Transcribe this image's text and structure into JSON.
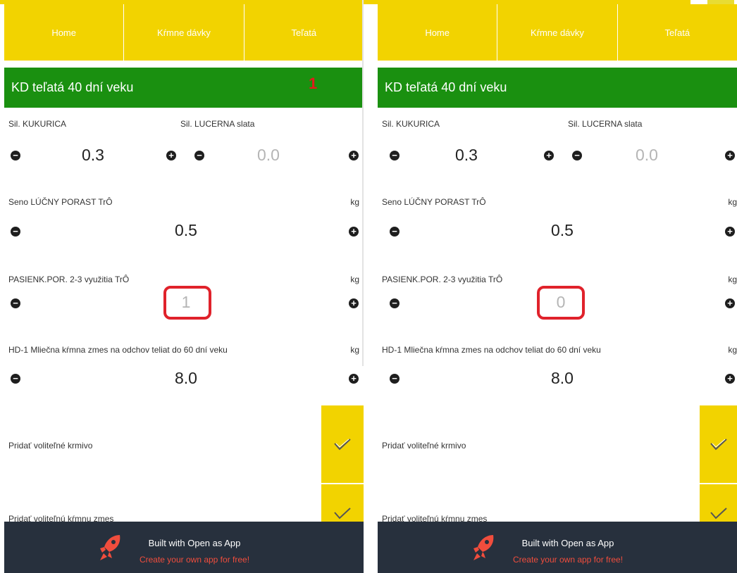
{
  "nav": {
    "tabs": [
      "Home",
      "Kŕmne dávky",
      "Teľatá"
    ]
  },
  "banner": {
    "title": "KD teľatá 40 dní veku",
    "badge": "1"
  },
  "rows": [
    {
      "label_left": "Sil. KUKURICA",
      "label_right": "Sil. LUCERNA slata",
      "value_left": "0.3",
      "value_right": "0.0"
    },
    {
      "label": "Seno LÚČNY PORAST TrÔ",
      "unit": "kg",
      "value": "0.5"
    },
    {
      "label": "PASIENK.POR. 2-3 využitia TrÔ",
      "unit": "kg"
    },
    {
      "label": "HD-1 Mliečna kŕmna zmes na odchov teliat do 60 dní veku",
      "unit": "kg",
      "value": "8.0"
    }
  ],
  "screens": {
    "left": {
      "pasienk_value": "1"
    },
    "right": {
      "pasienk_value": "0"
    }
  },
  "options": {
    "add_feed": "Pridať voliteľné krmivo",
    "add_mix": "Pridať voliteľnú kŕmnu zmes"
  },
  "promo": {
    "title": "Built with Open as App",
    "subtitle": "Create your own app for free!"
  },
  "icons": {
    "minus": "minus-circle-icon",
    "plus": "plus-circle-icon",
    "check": "check-icon",
    "rocket": "rocket-icon"
  },
  "colors": {
    "nav": "#f2d300",
    "banner": "#1a9010",
    "badge": "#e21b1b",
    "highlight": "#e0222b",
    "promo_bg": "#27303d",
    "promo_sub": "#f04d3d"
  }
}
